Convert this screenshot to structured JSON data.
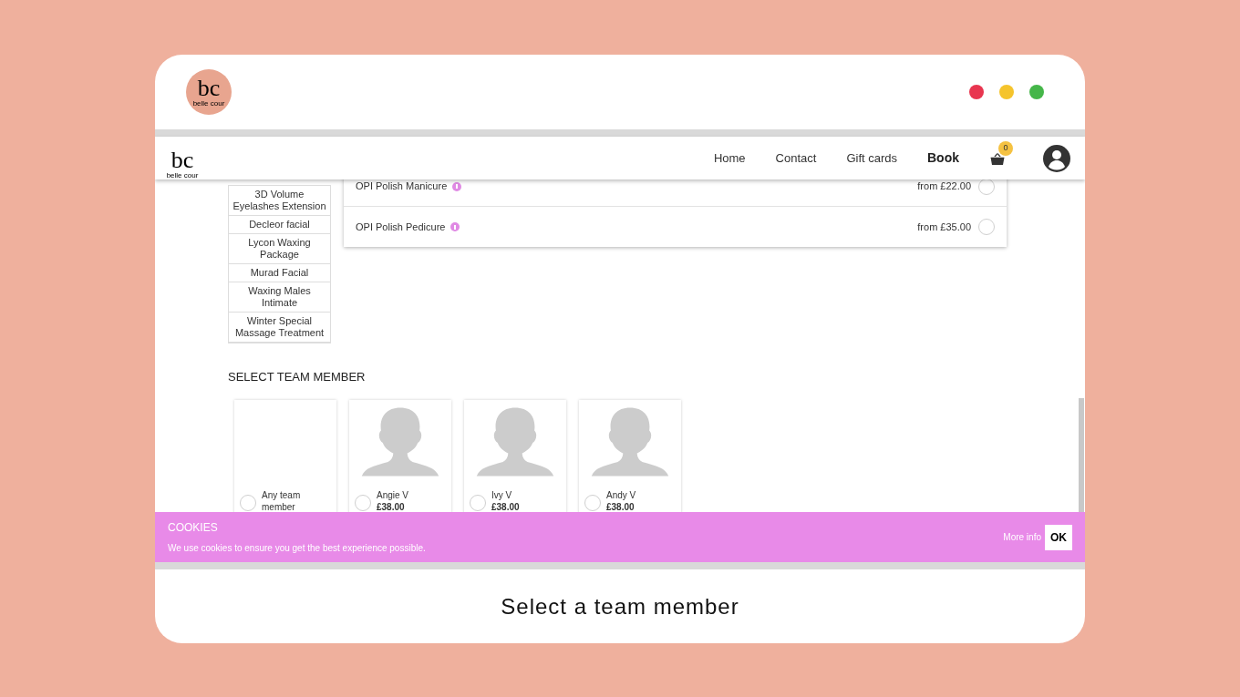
{
  "header": {
    "logo": {
      "letters": "bc",
      "caption": "belle cour"
    },
    "window_dots": [
      {
        "color": "#e8354f"
      },
      {
        "color": "#f5c42c"
      },
      {
        "color": "#45b649"
      }
    ]
  },
  "navbar": {
    "logo": {
      "letters": "bc",
      "caption": "belle cour"
    },
    "links": [
      {
        "label": "Home",
        "selected": false
      },
      {
        "label": "Contact",
        "selected": false
      },
      {
        "label": "Gift cards",
        "selected": false
      },
      {
        "label": "Book",
        "selected": true
      }
    ],
    "cart_count": "0"
  },
  "categories": [
    "3D Volume Eyelashes Extension",
    "Decleor facial",
    "Lycon Waxing Package",
    "Murad Facial",
    "Waxing Males Intimate",
    "Winter Special Massage Treatment"
  ],
  "services": [
    {
      "name": "OPI Polish Manicure",
      "price": "from £22.00",
      "selected": false
    },
    {
      "name": "OPI Polish Pedicure",
      "price": "from £35.00",
      "selected": false
    }
  ],
  "team": {
    "heading": "SELECT TEAM MEMBER",
    "members": [
      {
        "kind": "any",
        "name": "Any team member",
        "selected": false
      },
      {
        "kind": "person",
        "name": "Angie V",
        "price": "£38.00",
        "selected": false
      },
      {
        "kind": "person",
        "name": "Ivy V",
        "price": "£38.00",
        "selected": false
      },
      {
        "kind": "person",
        "name": "Andy V",
        "price": "£38.00",
        "selected": false
      }
    ]
  },
  "cookie_banner": {
    "title": "COOKIES",
    "text": "We use cookies to ensure you get the best experience possible.",
    "more_info": "More info",
    "ok": "OK"
  },
  "caption": "Select a team member"
}
